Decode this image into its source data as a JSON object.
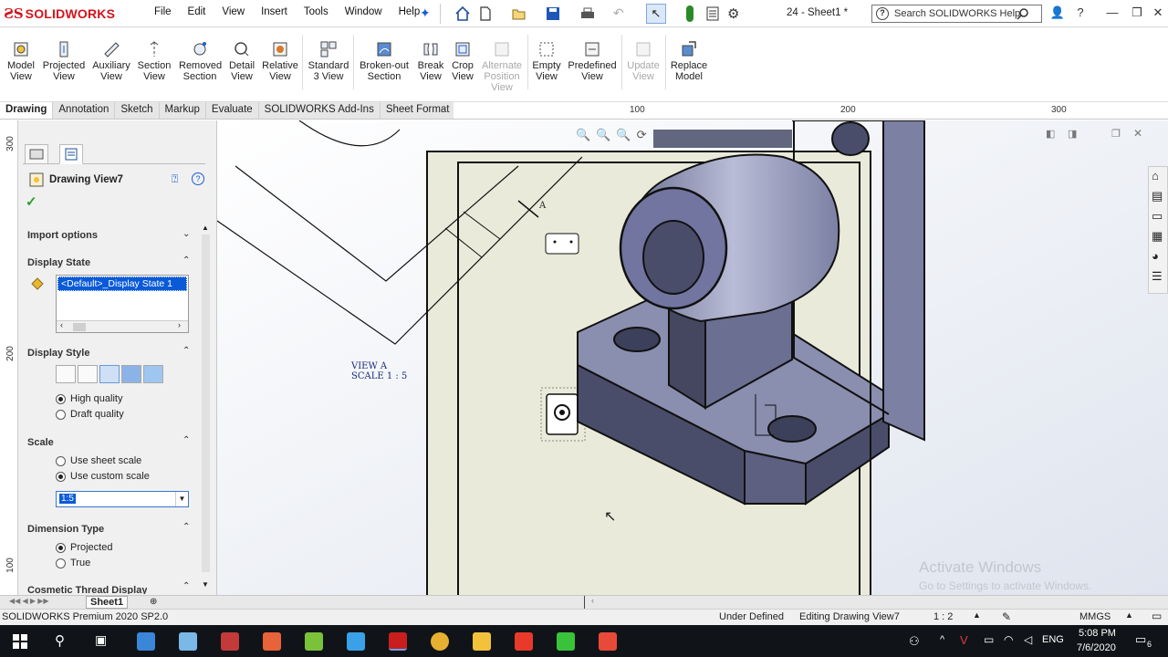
{
  "app": {
    "brand": "SOLIDWORKS",
    "document_title": "24 - Sheet1 *",
    "menus": [
      "File",
      "Edit",
      "View",
      "Insert",
      "Tools",
      "Window",
      "Help"
    ],
    "search_placeholder": "Search SOLIDWORKS Help"
  },
  "ribbon": {
    "buttons": [
      {
        "label": "Model\nView",
        "enabled": true
      },
      {
        "label": "Projected\nView",
        "enabled": true
      },
      {
        "label": "Auxiliary\nView",
        "enabled": true
      },
      {
        "label": "Section\nView",
        "enabled": true
      },
      {
        "label": "Removed\nSection",
        "enabled": true
      },
      {
        "label": "Detail\nView",
        "enabled": true
      },
      {
        "label": "Relative\nView",
        "enabled": true
      },
      {
        "label": "Standard\n3 View",
        "enabled": true
      },
      {
        "label": "Broken-out\nSection",
        "enabled": true
      },
      {
        "label": "Break\nView",
        "enabled": true
      },
      {
        "label": "Crop\nView",
        "enabled": true
      },
      {
        "label": "Alternate\nPosition\nView",
        "enabled": false
      },
      {
        "label": "Empty\nView",
        "enabled": true
      },
      {
        "label": "Predefined\nView",
        "enabled": true
      },
      {
        "label": "Update\nView",
        "enabled": false
      },
      {
        "label": "Replace\nModel",
        "enabled": true
      }
    ]
  },
  "tabs": [
    "Drawing",
    "Annotation",
    "Sketch",
    "Markup",
    "Evaluate",
    "SOLIDWORKS Add-Ins",
    "Sheet Format"
  ],
  "ruler": {
    "labels": [
      "100",
      "200",
      "300"
    ],
    "vlabels": [
      "300",
      "200",
      "100"
    ]
  },
  "panel": {
    "title": "Drawing View7",
    "import_options": "Import options",
    "display_state": {
      "header": "Display State",
      "selected": "<Default>_Display State 1"
    },
    "display_style": {
      "header": "Display Style",
      "high_quality": "High quality",
      "draft_quality": "Draft quality"
    },
    "scale": {
      "header": "Scale",
      "sheet": "Use sheet scale",
      "custom": "Use custom scale",
      "value": "1:5"
    },
    "dimension_type": {
      "header": "Dimension Type",
      "projected": "Projected",
      "true": "True"
    },
    "cosmetic": "Cosmetic Thread Display"
  },
  "canvas": {
    "view_label": "VIEW A",
    "view_scale": "SCALE 1 : 5",
    "arrow_label": "A",
    "watermark_title": "Activate Windows",
    "watermark_sub": "Go to Settings to activate Windows."
  },
  "sheet_tab": "Sheet1",
  "status": {
    "product": "SOLIDWORKS Premium 2020 SP2.0",
    "state": "Under Defined",
    "editing": "Editing Drawing View7",
    "scale": "1 : 2",
    "units": "MMGS"
  },
  "taskbar": {
    "lang": "ENG",
    "time": "5:08 PM",
    "date": "7/6/2020",
    "notifications": "6"
  }
}
